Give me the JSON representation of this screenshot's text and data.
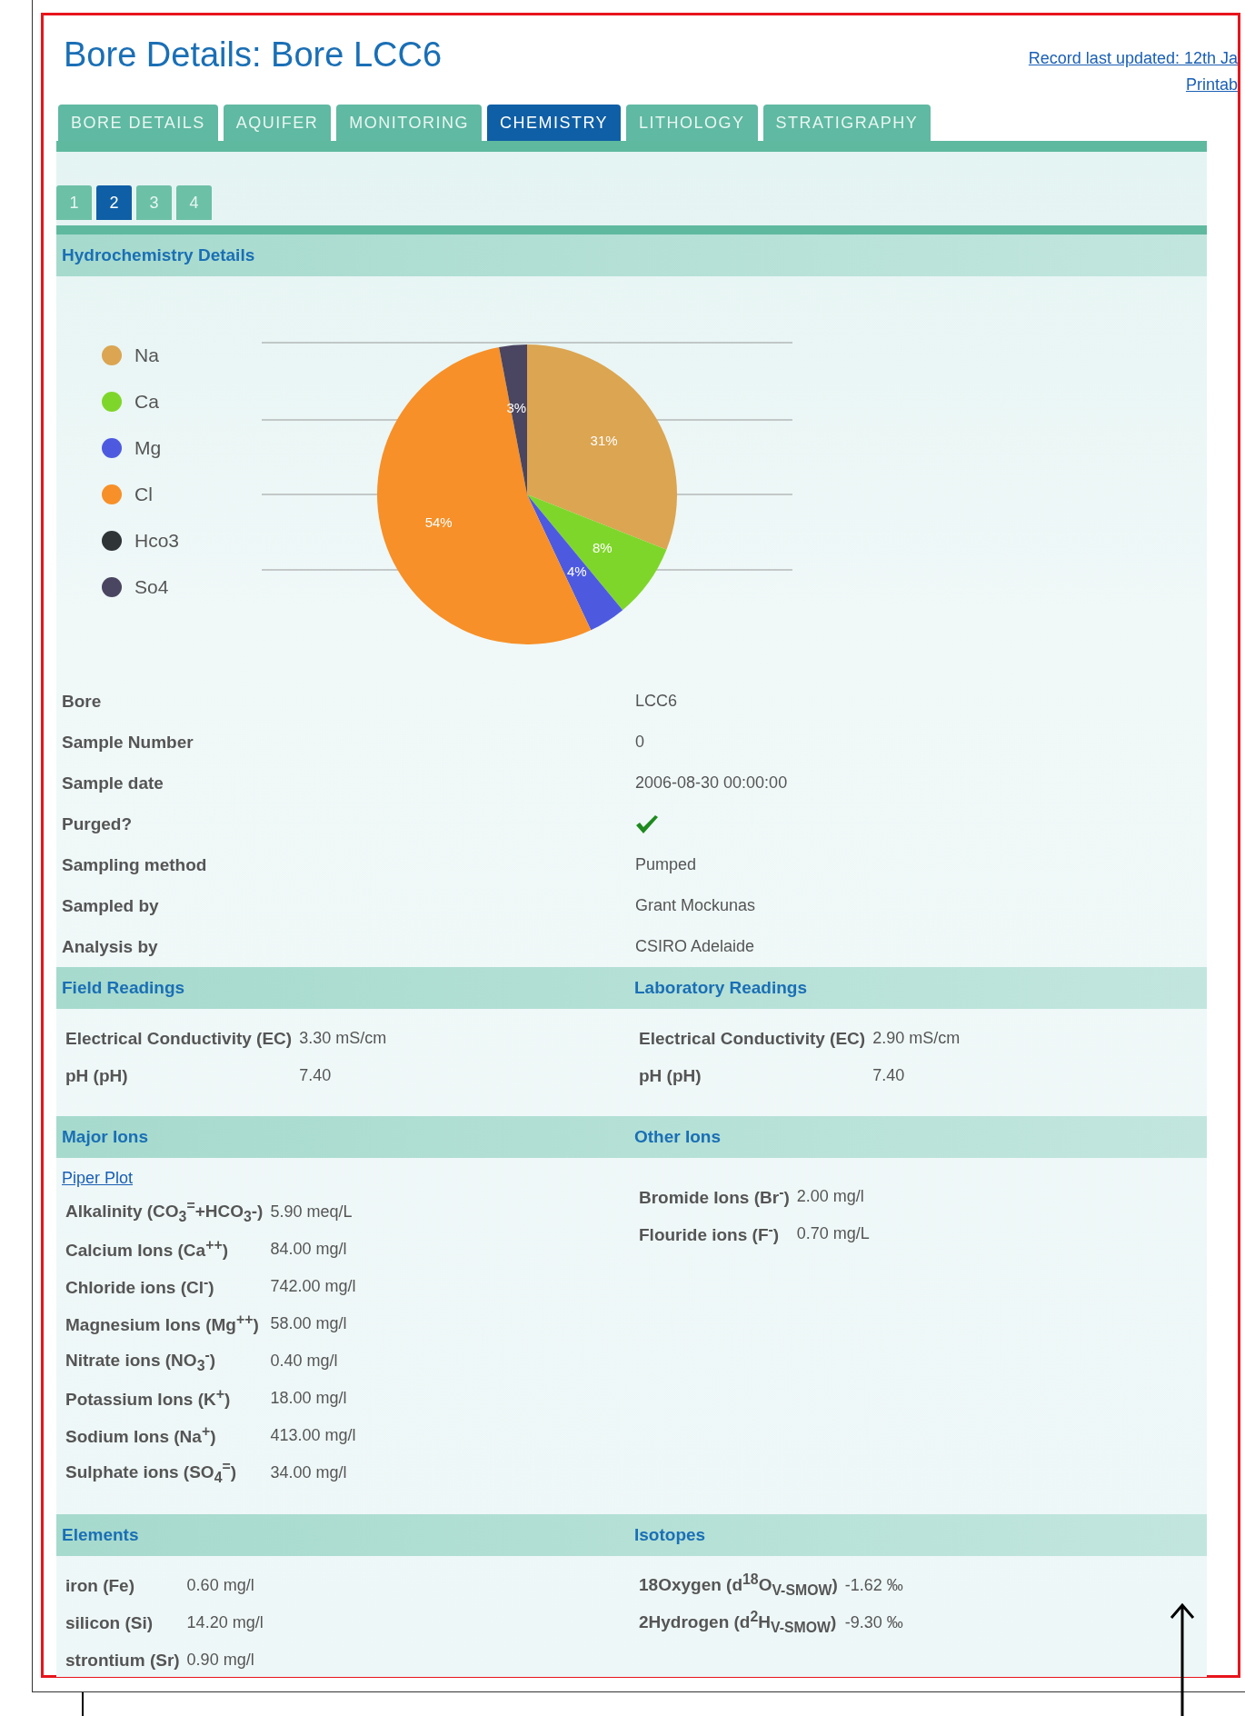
{
  "title": "Bore Details: Bore LCC6",
  "header_links": [
    "Record last updated: 12th Ja",
    "Printab"
  ],
  "tabs": [
    {
      "label": "BORE DETAILS",
      "selected": false
    },
    {
      "label": "AQUIFER",
      "selected": false
    },
    {
      "label": "MONITORING",
      "selected": false
    },
    {
      "label": "CHEMISTRY",
      "selected": true
    },
    {
      "label": "LITHOLOGY",
      "selected": false
    },
    {
      "label": "STRATIGRAPHY",
      "selected": false
    }
  ],
  "subtabs": [
    {
      "label": "1",
      "selected": false
    },
    {
      "label": "2",
      "selected": true
    },
    {
      "label": "3",
      "selected": false
    },
    {
      "label": "4",
      "selected": false
    }
  ],
  "hydrochemistry": {
    "title": "Hydrochemistry Details",
    "legend": [
      {
        "color": "#dba552"
      },
      {
        "color": "#7fd62a"
      },
      {
        "color": "#4d5ae0"
      },
      {
        "color": "#f79028"
      },
      {
        "color": "#2f3436"
      },
      {
        "color": "#4a4560"
      }
    ],
    "chart_data": {
      "type": "pie",
      "categories": [
        "Na",
        "Ca",
        "Mg",
        "Cl",
        "Hco3",
        "So4"
      ],
      "values": [
        31,
        8,
        4,
        54,
        0,
        3
      ],
      "value_labels": [
        "31%",
        "8%",
        "4%",
        "54%",
        null,
        "3%"
      ]
    }
  },
  "details": [
    {
      "label": "Bore",
      "kind": "text",
      "value": "LCC6"
    },
    {
      "label": "Sample Number",
      "kind": "text",
      "value": "0"
    },
    {
      "label": "Sample date",
      "kind": "text",
      "value": "2006-08-30 00:00:00"
    },
    {
      "label": "Purged?",
      "kind": "check",
      "checked": true
    },
    {
      "label": "Sampling method",
      "kind": "text",
      "value": "Pumped"
    },
    {
      "label": "Sampled by",
      "kind": "text",
      "value": "Grant Mockunas"
    },
    {
      "label": "Analysis by",
      "kind": "text",
      "value": "CSIRO Adelaide"
    }
  ],
  "panels": [
    {
      "left": {
        "title": "Field Readings",
        "rows": [
          {
            "label": "Electrical Conductivity (EC)",
            "value": "3.30 mS/cm"
          },
          {
            "label": "pH (pH)",
            "value": "7.40"
          }
        ]
      },
      "right": {
        "title": "Laboratory Readings",
        "rows": [
          {
            "label": "Electrical Conductivity (EC)",
            "value": "2.90 mS/cm"
          },
          {
            "label": "pH (pH)",
            "value": "7.40"
          }
        ]
      }
    },
    {
      "left": {
        "title": "Major Ions",
        "link": "Piper Plot",
        "rows": [
          {
            "label": "Alkalinity (CO$_{3}$$^{=}$+HCO$_{3}$-)",
            "value": "5.90 meq/L"
          },
          {
            "label": "Calcium Ions (Ca$^{++}$)",
            "value": "84.00 mg/l"
          },
          {
            "label": "Chloride ions (Cl$^{-}$)",
            "value": "742.00 mg/l"
          },
          {
            "label": "Magnesium Ions (Mg$^{++}$)",
            "value": "58.00 mg/l"
          },
          {
            "label": "Nitrate ions (NO$_{3}$$^{-}$)",
            "value": "0.40 mg/l"
          },
          {
            "label": "Potassium Ions (K$^{+}$)",
            "value": "18.00 mg/l"
          },
          {
            "label": "Sodium Ions (Na$^{+}$)",
            "value": "413.00 mg/l"
          },
          {
            "label": "Sulphate ions (SO$_{4}$$^{=}$)",
            "value": "34.00 mg/l"
          }
        ]
      },
      "right": {
        "title": "Other Ions",
        "rows": [
          {
            "label": "Bromide Ions (Br$^{-}$)",
            "value": "2.00 mg/l"
          },
          {
            "label": "Flouride ions (F$^{-}$)",
            "value": "0.70 mg/L"
          }
        ]
      }
    },
    {
      "left": {
        "title": "Elements",
        "rows": [
          {
            "label": "iron (Fe)",
            "value": "0.60 mg/l"
          },
          {
            "label": "silicon (Si)",
            "value": "14.20 mg/l"
          },
          {
            "label": "strontium (Sr)",
            "value": "0.90 mg/l"
          }
        ]
      },
      "right": {
        "title": "Isotopes",
        "rows": [
          {
            "label": "18Oxygen (d$^{18}$O$_{V-SMOW}$)",
            "value": "-1.62 ‰"
          },
          {
            "label": "2Hydrogen (d$^{2}$H$_{V-SMOW}$)",
            "value": "-9.30 ‰"
          }
        ]
      }
    }
  ]
}
